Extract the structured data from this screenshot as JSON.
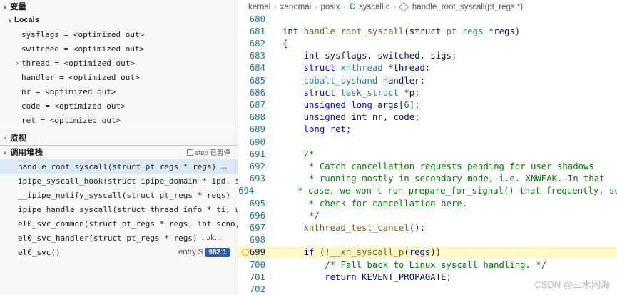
{
  "variables": {
    "header": "变量",
    "locals_label": "Locals",
    "items": [
      {
        "name": "sysflags",
        "value": "sysflags = <optimized out>",
        "expandable": false
      },
      {
        "name": "switched",
        "value": "switched = <optimized out>",
        "expandable": false
      },
      {
        "name": "thread",
        "value": "thread = <optimized out>",
        "expandable": true
      },
      {
        "name": "handler",
        "value": "handler = <optimized out>",
        "expandable": false
      },
      {
        "name": "nr",
        "value": "nr = <optimized out>",
        "expandable": false
      },
      {
        "name": "code",
        "value": "code = <optimized out>",
        "expandable": false
      },
      {
        "name": "ret",
        "value": "ret = <optimized out>",
        "expandable": false
      }
    ]
  },
  "watch": {
    "header": "监视"
  },
  "call_stack": {
    "header": "调用堆栈",
    "status": "step 已暂停",
    "frames": [
      {
        "fn": "handle_root_syscall(struct pt_regs * regs)",
        "src": "...",
        "selected": true
      },
      {
        "fn": "ipipe_syscall_hook(struct ipipe_domain * ipd, st",
        "src": ""
      },
      {
        "fn": "__ipipe_notify_syscall(struct pt_regs * regs)",
        "src": ""
      },
      {
        "fn": "ipipe_handle_syscall(struct thread_info * ti, un",
        "src": ""
      },
      {
        "fn": "el0_svc_common(struct pt_regs * regs, int scno,",
        "src": ""
      },
      {
        "fn": "el0_svc_handler(struct pt_regs * regs)",
        "src": ".../k..."
      },
      {
        "fn": "el0_svc()",
        "src": "entry.S",
        "badge": "982:1"
      }
    ]
  },
  "breadcrumb": [
    "kernel",
    "xenomai",
    "posix",
    "syscall.c",
    "handle_root_syscall(pt_regs *)"
  ],
  "code_lines": [
    {
      "n": "680",
      "html": ""
    },
    {
      "n": "681",
      "html": "<span class='k'>int</span> <span class='f'>handle_root_syscall</span>(<span class='k'>struct</span> <span class='t'>pt_regs</span> *<span class='v'>regs</span>)"
    },
    {
      "n": "682",
      "html": "<span class='k'>{</span>"
    },
    {
      "n": "683",
      "html": "    <span class='k'>int</span> <span class='v'>sysflags</span>, <span class='v'>switched</span>, <span class='v'>sigs</span>;"
    },
    {
      "n": "684",
      "html": "    <span class='k'>struct</span> <span class='t'>xnthread</span> *<span class='v'>thread</span>;"
    },
    {
      "n": "685",
      "html": "    <span class='t'>cobalt_syshand</span> <span class='v'>handler</span>;"
    },
    {
      "n": "686",
      "html": "    <span class='k'>struct</span> <span class='t'>task_struct</span> *<span class='v'>p</span>;"
    },
    {
      "n": "687",
      "html": "    <span class='k'>unsigned</span> <span class='k'>long</span> <span class='v'>args</span>[<span class='n'>6</span>];"
    },
    {
      "n": "688",
      "html": "    <span class='k'>unsigned</span> <span class='k'>int</span> <span class='v'>nr</span>, <span class='v'>code</span>;"
    },
    {
      "n": "689",
      "html": "    <span class='k'>long</span> <span class='v'>ret</span>;"
    },
    {
      "n": "690",
      "html": ""
    },
    {
      "n": "691",
      "html": "    <span class='cm'>/*</span>"
    },
    {
      "n": "692",
      "html": "    <span class='cm'> * Catch cancellation requests pending for user shadows</span>"
    },
    {
      "n": "693",
      "html": "    <span class='cm'> * running mostly in secondary mode, i.e. XNWEAK. In that</span>"
    },
    {
      "n": "694",
      "html": "    <span class='cm'> * case, we won't run prepare_for_signal() that frequently, so</span>"
    },
    {
      "n": "695",
      "html": "    <span class='cm'> * check for cancellation here.</span>"
    },
    {
      "n": "696",
      "html": "    <span class='cm'> */</span>"
    },
    {
      "n": "697",
      "html": "    <span class='f'>xnthread_test_cancel</span>();"
    },
    {
      "n": "698",
      "html": ""
    },
    {
      "n": "699",
      "html": "    <span class='k'>if</span> (!<span class='f'>__xn_syscall_p</span>(<span class='v'>regs</span>))",
      "current": true
    },
    {
      "n": "700",
      "html": "        <span class='cm'>/* Fall back to Linux syscall handling. */</span>"
    },
    {
      "n": "701",
      "html": "        <span class='k'>return</span> <span class='v'>KEVENT_PROPAGATE</span>;"
    },
    {
      "n": "702",
      "html": ""
    }
  ],
  "watermark": "CSDN @三水问海"
}
